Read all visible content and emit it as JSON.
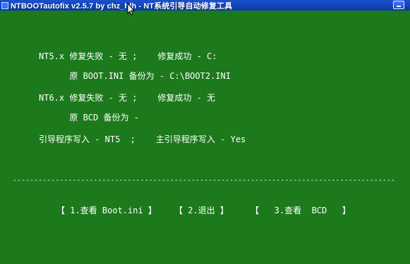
{
  "window": {
    "title": "NTBOOTautofix v2.5.7 by chz_hlh - NT系统引导自动修复工具"
  },
  "console": {
    "lines": [
      "NT5.x 修复失败 - 无 ;    修复成功 - C:",
      "      原 BOOT.INI 备份为 - C:\\BOOT2.INI",
      "NT6.x 修复失败 - 无 ;    修复成功 - 无",
      "      原 BCD 备份为 -",
      "引导程序写入 - NT5  ;    主引导程序写入 - Yes"
    ],
    "separator": "------------------------------------------------------------------------------------------"
  },
  "menu": {
    "items": [
      "【 1.查看 Boot.ini 】",
      "【 2.退出 】",
      "【   3.查看  BCD   】"
    ]
  },
  "colors": {
    "background": "#1c7a1c",
    "text": "#ffffff",
    "titlebar": "#0b3aa4"
  },
  "icons": {
    "app": "app-icon",
    "minimize": "minimize-icon",
    "cursor": "mouse-pointer-icon"
  }
}
